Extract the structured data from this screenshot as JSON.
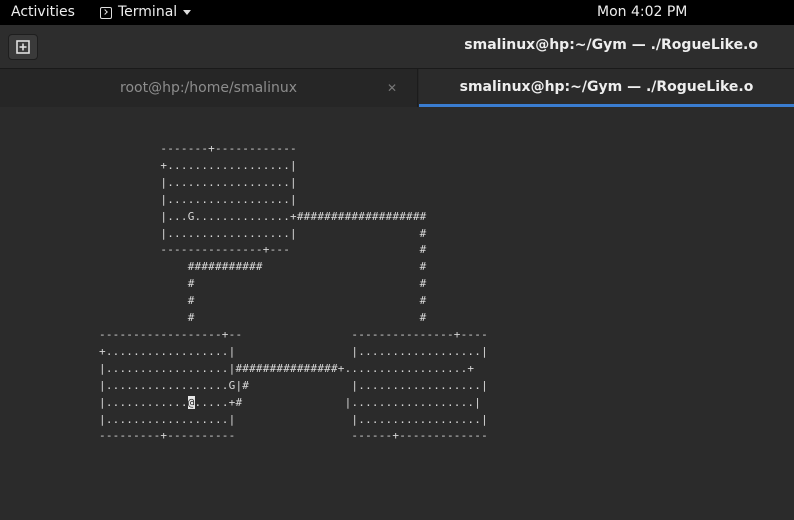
{
  "topbar": {
    "activities": "Activities",
    "app_menu": "Terminal",
    "clock": "Mon  4:02 PM"
  },
  "headerbar": {
    "title": "smalinux@hp:~/Gym — ./RogueLike.o"
  },
  "tabs": [
    {
      "label": "root@hp:/home/smalinux",
      "active": false
    },
    {
      "label": "smalinux@hp:~/Gym — ./RogueLike.o",
      "active": true
    }
  ],
  "terminal": {
    "lines_before_cursor": "         -------+------------\n         +..................|\n         |..................|\n         |..................|\n         |...G..............+###################\n         |..................|                  #\n         ---------------+---                   #\n             ###########                       #\n             #                                 #\n             #                                 #\n             #                                 #\n------------------+--                ---------------+----\n+..................|                 |..................|\n|..................|###############+..................+\n|..................G|#               |..................|\n|............",
    "cursor_char": "@",
    "lines_after_cursor": ".....+#               |..................|\n|..................|                 |..................|\n---------+----------                 ------+-------------"
  },
  "colors": {
    "accent": "#3a7dd1",
    "background": "#2b2b2b"
  }
}
